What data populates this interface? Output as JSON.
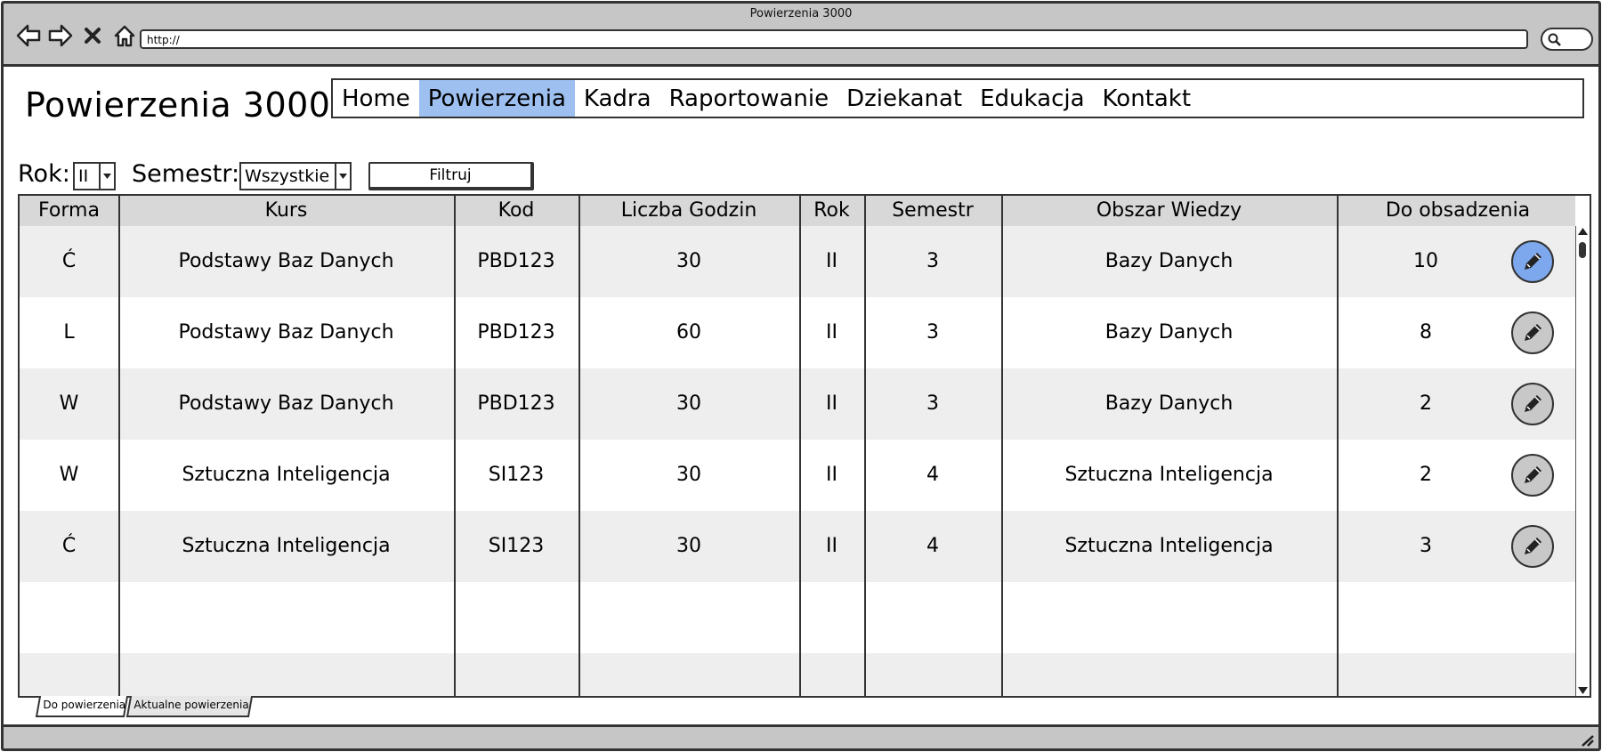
{
  "window": {
    "title": "Powierzenia 3000",
    "url": "http://"
  },
  "header": {
    "app_title": "Powierzenia 3000"
  },
  "nav": {
    "items": [
      {
        "label": "Home",
        "active": false
      },
      {
        "label": "Powierzenia",
        "active": true
      },
      {
        "label": "Kadra",
        "active": false
      },
      {
        "label": "Raportowanie",
        "active": false
      },
      {
        "label": "Dziekanat",
        "active": false
      },
      {
        "label": "Edukacja",
        "active": false
      },
      {
        "label": "Kontakt",
        "active": false
      }
    ],
    "active_color": "#9ec0f0"
  },
  "filters": {
    "rok_label": "Rok:",
    "rok_value": "II",
    "semestr_label": "Semestr:",
    "semestr_value": "Wszystkie",
    "filter_button": "Filtruj"
  },
  "table": {
    "columns": [
      "Forma",
      "Kurs",
      "Kod",
      "Liczba Godzin",
      "Rok",
      "Semestr",
      "Obszar Wiedzy",
      "Do obsadzenia"
    ],
    "rows": [
      {
        "forma": "Ć",
        "kurs": "Podstawy Baz Danych",
        "kod": "PBD123",
        "godziny": "30",
        "rok": "II",
        "semestr": "3",
        "obszar": "Bazy Danych",
        "do_obsadzenia": "10",
        "selected": true
      },
      {
        "forma": "L",
        "kurs": "Podstawy Baz Danych",
        "kod": "PBD123",
        "godziny": "60",
        "rok": "II",
        "semestr": "3",
        "obszar": "Bazy Danych",
        "do_obsadzenia": "8",
        "selected": false
      },
      {
        "forma": "W",
        "kurs": "Podstawy Baz Danych",
        "kod": "PBD123",
        "godziny": "30",
        "rok": "II",
        "semestr": "3",
        "obszar": "Bazy Danych",
        "do_obsadzenia": "2",
        "selected": false
      },
      {
        "forma": "W",
        "kurs": "Sztuczna Inteligencja",
        "kod": "SI123",
        "godziny": "30",
        "rok": "II",
        "semestr": "4",
        "obszar": "Sztuczna Inteligencja",
        "do_obsadzenia": "2",
        "selected": false
      },
      {
        "forma": "Ć",
        "kurs": "Sztuczna Inteligencja",
        "kod": "SI123",
        "godziny": "30",
        "rok": "II",
        "semestr": "4",
        "obszar": "Sztuczna Inteligencja",
        "do_obsadzenia": "3",
        "selected": false
      }
    ],
    "row_icon": "pencil-icon",
    "selected_color": "#7ea8ee"
  },
  "tabs": [
    {
      "label": "Do powierzenia",
      "active": true
    },
    {
      "label": "Aktualne powierzenia",
      "active": false
    }
  ]
}
